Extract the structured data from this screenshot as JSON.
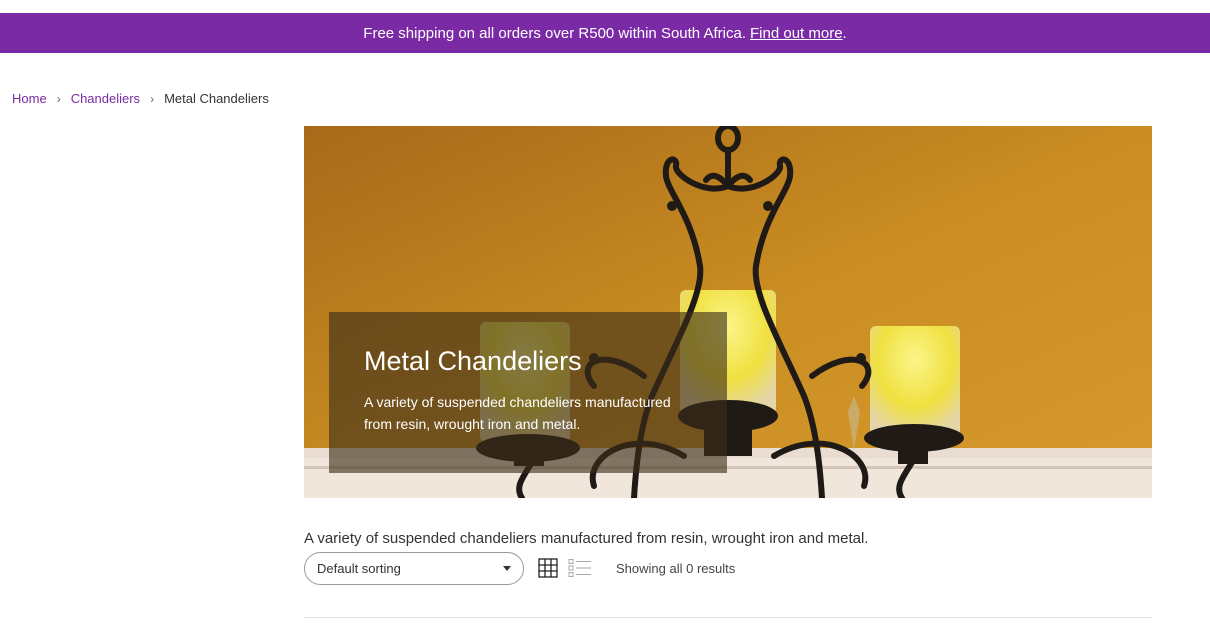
{
  "promo": {
    "text": "Free shipping on all orders over R500 within South Africa.",
    "link": "Find out more",
    "suffix": ".",
    "color": "#7b2aa5"
  },
  "breadcrumb": {
    "items": [
      "Home",
      "Chandeliers",
      "Metal Chandeliers"
    ]
  },
  "hero": {
    "title": "Metal Chandeliers",
    "description": "A variety of suspended chandeliers manufactured from resin, wrought iron and metal."
  },
  "category": {
    "description": "A variety of suspended chandeliers manufactured from resin, wrought iron and metal."
  },
  "toolbar": {
    "sort_value": "Default sorting",
    "grid_icon": "grid-view-icon",
    "list_icon": "list-view-icon",
    "results": "Showing all 0 results"
  }
}
